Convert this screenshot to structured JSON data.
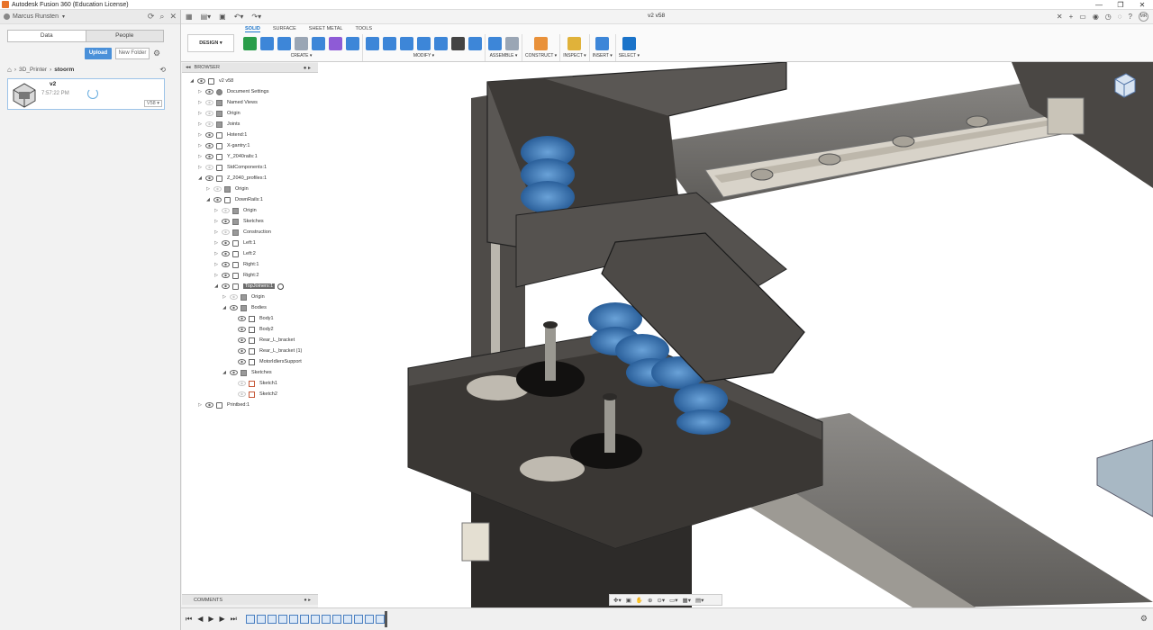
{
  "window": {
    "title": "Autodesk Fusion 360 (Education License)",
    "controls": [
      "—",
      "❐",
      "✕"
    ]
  },
  "data_panel": {
    "user": "Marcus Runsten",
    "tabs": [
      "Data",
      "People"
    ],
    "upload_label": "Upload",
    "new_folder_label": "New Folder",
    "breadcrumb": [
      "3D_Printer",
      "stoorm"
    ],
    "file": {
      "name": "v2",
      "time": "7:57:22 PM",
      "version": "V58 ▾"
    }
  },
  "topbar": {
    "doc_title": "v2 v58",
    "avatar": "MR"
  },
  "ribbon": {
    "tabs": [
      "SOLID",
      "SURFACE",
      "SHEET METAL",
      "TOOLS"
    ],
    "active_tab": "SOLID",
    "workspace": "DESIGN ▾",
    "groups": [
      {
        "label": "CREATE ▾",
        "icons": [
          "new-component-icon",
          "extrude-icon",
          "revolve-icon",
          "hole-icon",
          "pattern-icon",
          "sphere-icon",
          "shell-icon"
        ],
        "colors": [
          "#2a9d4a",
          "#3d86d8",
          "#3d86d8",
          "#9aa6b5",
          "#3d86d8",
          "#8e5bd6",
          "#3d86d8"
        ]
      },
      {
        "label": "MODIFY ▾",
        "icons": [
          "press-pull-icon",
          "fillet-icon",
          "chamfer-icon",
          "combine-icon",
          "split-icon",
          "move-icon",
          "align-icon"
        ],
        "colors": [
          "#3d86d8",
          "#3d86d8",
          "#3d86d8",
          "#3d86d8",
          "#3d86d8",
          "#444444",
          "#3d86d8"
        ]
      },
      {
        "label": "ASSEMBLE ▾",
        "icons": [
          "assemble-new-icon",
          "joint-icon"
        ],
        "colors": [
          "#3d86d8",
          "#9aa6b5"
        ]
      },
      {
        "label": "CONSTRUCT ▾",
        "icons": [
          "construct-plane-icon"
        ],
        "colors": [
          "#e9913a"
        ]
      },
      {
        "label": "INSPECT ▾",
        "icons": [
          "measure-icon"
        ],
        "colors": [
          "#e0b23a"
        ]
      },
      {
        "label": "INSERT ▾",
        "icons": [
          "insert-image-icon"
        ],
        "colors": [
          "#3d86d8"
        ]
      },
      {
        "label": "SELECT ▾",
        "icons": [
          "select-icon"
        ],
        "colors": [
          "#1a73c9"
        ]
      }
    ]
  },
  "browser": {
    "header": "BROWSER",
    "rows": [
      {
        "label": "v2 v58",
        "level": 0,
        "arrow": "◢",
        "icon": "comp",
        "eye": true
      },
      {
        "label": "Document Settings",
        "level": 1,
        "arrow": "▷",
        "icon": "gear",
        "eye": true
      },
      {
        "label": "Named Views",
        "level": 1,
        "arrow": "▷",
        "icon": "folder",
        "eye": false
      },
      {
        "label": "Origin",
        "level": 1,
        "arrow": "▷",
        "icon": "folder",
        "eye": "dim"
      },
      {
        "label": "Joints",
        "level": 1,
        "arrow": "▷",
        "icon": "folder",
        "eye": "dim"
      },
      {
        "label": "Hotend:1",
        "level": 1,
        "arrow": "▷",
        "icon": "comp",
        "eye": true
      },
      {
        "label": "X-gantry:1",
        "level": 1,
        "arrow": "▷",
        "icon": "comp",
        "eye": true
      },
      {
        "label": "Y_2040rails:1",
        "level": 1,
        "arrow": "▷",
        "icon": "comp",
        "eye": true
      },
      {
        "label": "StdComponents:1",
        "level": 1,
        "arrow": "▷",
        "icon": "comp",
        "eye": "dim"
      },
      {
        "label": "Z_2040_profiles:1",
        "level": 1,
        "arrow": "◢",
        "icon": "comp",
        "eye": true
      },
      {
        "label": "Origin",
        "level": 2,
        "arrow": "▷",
        "icon": "folder",
        "eye": "dim"
      },
      {
        "label": "DownRails:1",
        "level": 2,
        "arrow": "◢",
        "icon": "comp",
        "eye": true
      },
      {
        "label": "Origin",
        "level": 3,
        "arrow": "▷",
        "icon": "folder",
        "eye": "dim"
      },
      {
        "label": "Sketches",
        "level": 3,
        "arrow": "▷",
        "icon": "folder",
        "eye": true
      },
      {
        "label": "Construction",
        "level": 3,
        "arrow": "▷",
        "icon": "folder",
        "eye": "dim"
      },
      {
        "label": "Left:1",
        "level": 3,
        "arrow": "▷",
        "icon": "comp",
        "eye": true
      },
      {
        "label": "Left:2",
        "level": 3,
        "arrow": "▷",
        "icon": "comp",
        "eye": true
      },
      {
        "label": "Right:1",
        "level": 3,
        "arrow": "▷",
        "icon": "comp",
        "eye": true
      },
      {
        "label": "Right:2",
        "level": 3,
        "arrow": "▷",
        "icon": "comp",
        "eye": true
      },
      {
        "label": "TopJoiners:1",
        "level": 3,
        "arrow": "◢",
        "icon": "comp",
        "eye": true,
        "selected": true
      },
      {
        "label": "Origin",
        "level": 4,
        "arrow": "▷",
        "icon": "folder",
        "eye": "dim"
      },
      {
        "label": "Bodies",
        "level": 4,
        "arrow": "◢",
        "icon": "folder",
        "eye": true
      },
      {
        "label": "Body1",
        "level": 5,
        "arrow": "",
        "icon": "body",
        "eye": true
      },
      {
        "label": "Body2",
        "level": 5,
        "arrow": "",
        "icon": "body",
        "eye": true
      },
      {
        "label": "Rear_L_bracket",
        "level": 5,
        "arrow": "",
        "icon": "body",
        "eye": true
      },
      {
        "label": "Rear_L_bracket (1)",
        "level": 5,
        "arrow": "",
        "icon": "body",
        "eye": true
      },
      {
        "label": "MotorIdlersSupport",
        "level": 5,
        "arrow": "",
        "icon": "body",
        "eye": true
      },
      {
        "label": "Sketches",
        "level": 4,
        "arrow": "◢",
        "icon": "folder",
        "eye": true
      },
      {
        "label": "Sketch1",
        "level": 5,
        "arrow": "",
        "icon": "sketch",
        "eye": "dim"
      },
      {
        "label": "Sketch2",
        "level": 5,
        "arrow": "",
        "icon": "sketch",
        "eye": "dim"
      },
      {
        "label": "Printbed:1",
        "level": 1,
        "arrow": "▷",
        "icon": "comp",
        "eye": true
      }
    ]
  },
  "comments": {
    "label": "COMMENTS"
  }
}
